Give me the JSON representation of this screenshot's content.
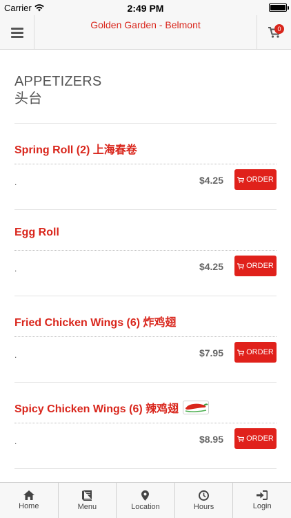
{
  "status_bar": {
    "carrier": "Carrier",
    "time": "2:49 PM"
  },
  "header": {
    "title": "Golden Garden - Belmont",
    "cart_count": "0"
  },
  "category": {
    "name_en": "APPETIZERS",
    "name_cn": "头台"
  },
  "items": [
    {
      "name": "Spring Roll (2) 上海春卷",
      "desc": ".",
      "price": "$4.25",
      "order_label": "ORDER",
      "spicy": false
    },
    {
      "name": "Egg Roll",
      "desc": ".",
      "price": "$4.25",
      "order_label": "ORDER",
      "spicy": false
    },
    {
      "name": "Fried Chicken Wings (6) 炸鸡翅",
      "desc": ".",
      "price": "$7.95",
      "order_label": "ORDER",
      "spicy": false
    },
    {
      "name": "Spicy Chicken Wings (6) 辣鸡翅",
      "desc": ".",
      "price": "$8.95",
      "order_label": "ORDER",
      "spicy": true
    }
  ],
  "bottom_nav": [
    {
      "label": "Home",
      "icon": "home-icon"
    },
    {
      "label": "Menu",
      "icon": "book-icon"
    },
    {
      "label": "Location",
      "icon": "map-pin-icon"
    },
    {
      "label": "Hours",
      "icon": "clock-icon"
    },
    {
      "label": "Login",
      "icon": "login-icon"
    }
  ],
  "colors": {
    "accent": "#d9261c",
    "order_button": "#e0211b"
  }
}
